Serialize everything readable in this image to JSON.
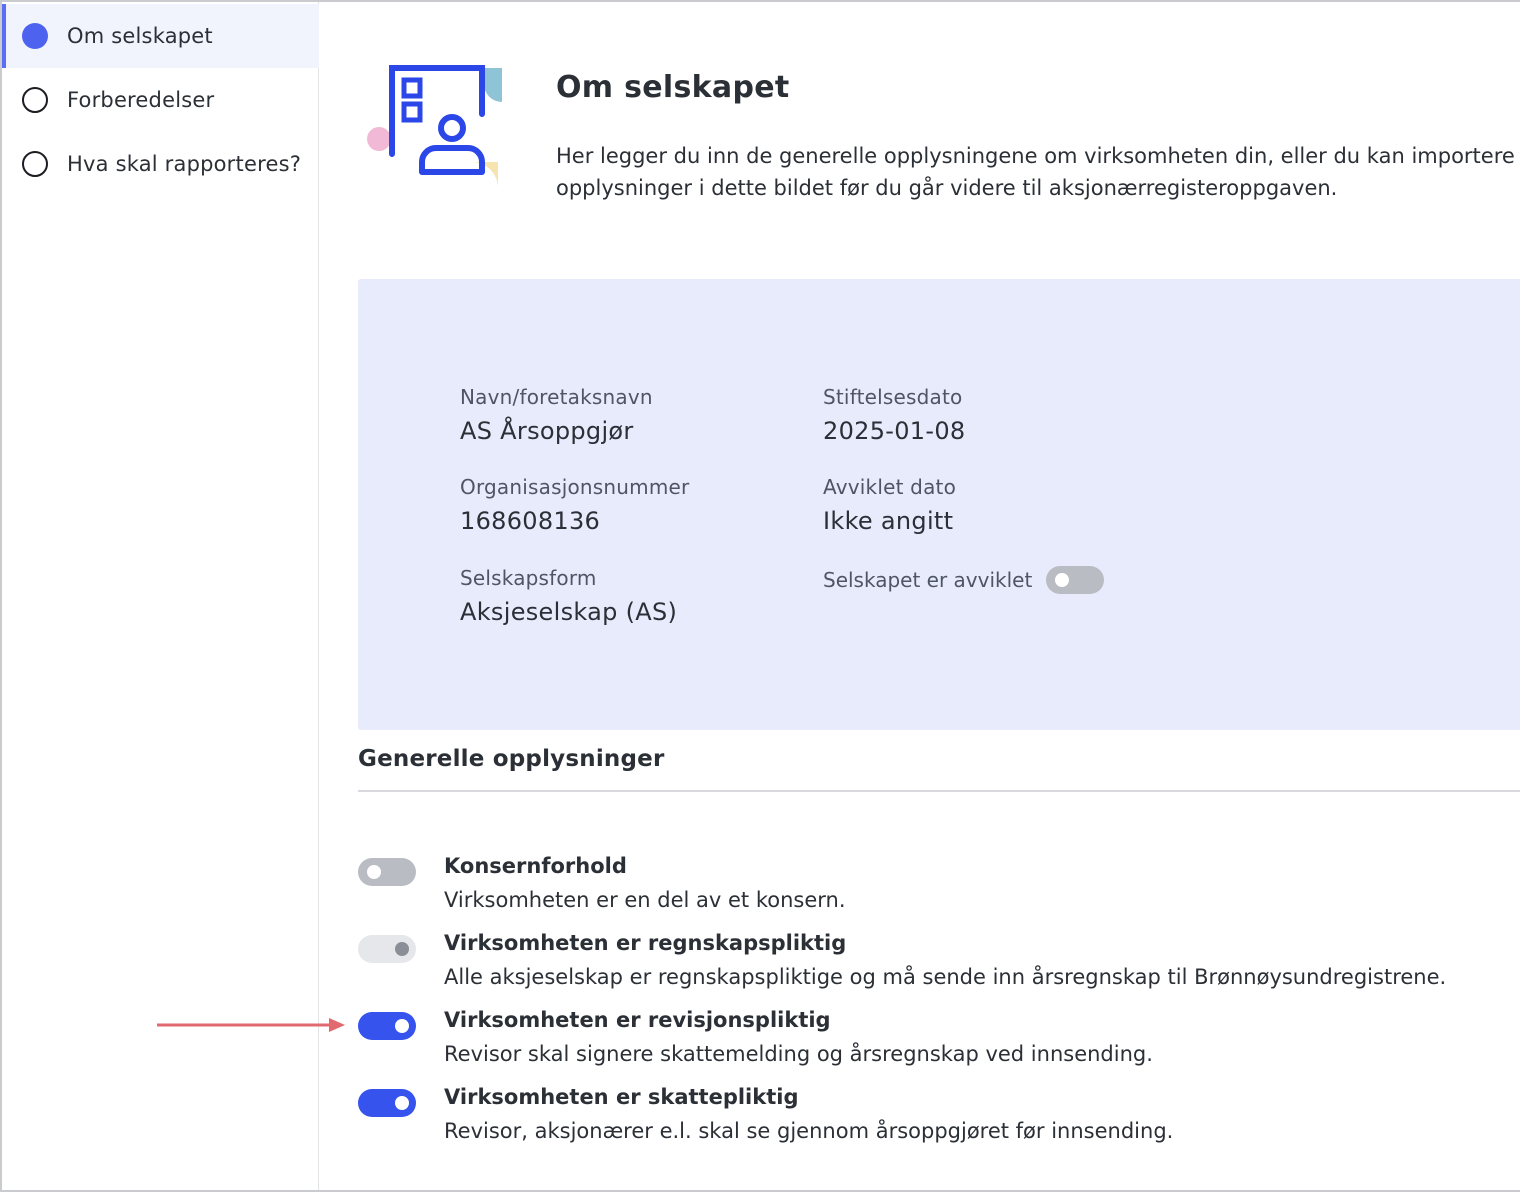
{
  "sidebar": {
    "items": [
      {
        "label": "Om selskapet",
        "active": true
      },
      {
        "label": "Forberedelser",
        "active": false
      },
      {
        "label": "Hva skal rapporteres?",
        "active": false
      }
    ]
  },
  "header": {
    "title": "Om selskapet",
    "intro_line1": "Her legger du inn de generelle opplysningene om virksomheten din, eller du kan importere for",
    "intro_line2": "opplysninger i dette bildet før du går videre til aksjonærregisteroppgaven."
  },
  "company": {
    "name_label": "Navn/foretaksnavn",
    "name_value": "AS Årsoppgjør",
    "founded_label": "Stiftelsesdato",
    "founded_value": "2025-01-08",
    "orgnr_label": "Organisasjonsnummer",
    "orgnr_value": "168608136",
    "dissolved_date_label": "Avviklet dato",
    "dissolved_date_value": "Ikke angitt",
    "form_label": "Selskapsform",
    "form_value": "Aksjeselskap (AS)",
    "dissolved_toggle_label": "Selskapet er avviklet",
    "dissolved_toggle_state": "off"
  },
  "general": {
    "section_title": "Generelle opplysninger",
    "settings": [
      {
        "title": "Konsernforhold",
        "description": "Virksomheten er en del av et konsern.",
        "state": "off"
      },
      {
        "title": "Virksomheten er regnskapspliktig",
        "description": "Alle aksjeselskap er regnskapspliktige og må sende inn årsregnskap til Brønnøysundregistrene.",
        "state": "on-disabled"
      },
      {
        "title": "Virksomheten er revisjonspliktig",
        "description": "Revisor skal signere skattemelding og årsregnskap ved innsending.",
        "state": "on"
      },
      {
        "title": "Virksomheten er skattepliktig",
        "description": "Revisor, aksjonærer e.l. skal se gjennom årsoppgjøret før innsending.",
        "state": "on"
      }
    ]
  },
  "colors": {
    "accent": "#3653ee",
    "panel_bg": "#e8ebfc",
    "annotation_arrow": "#e06a6f"
  }
}
